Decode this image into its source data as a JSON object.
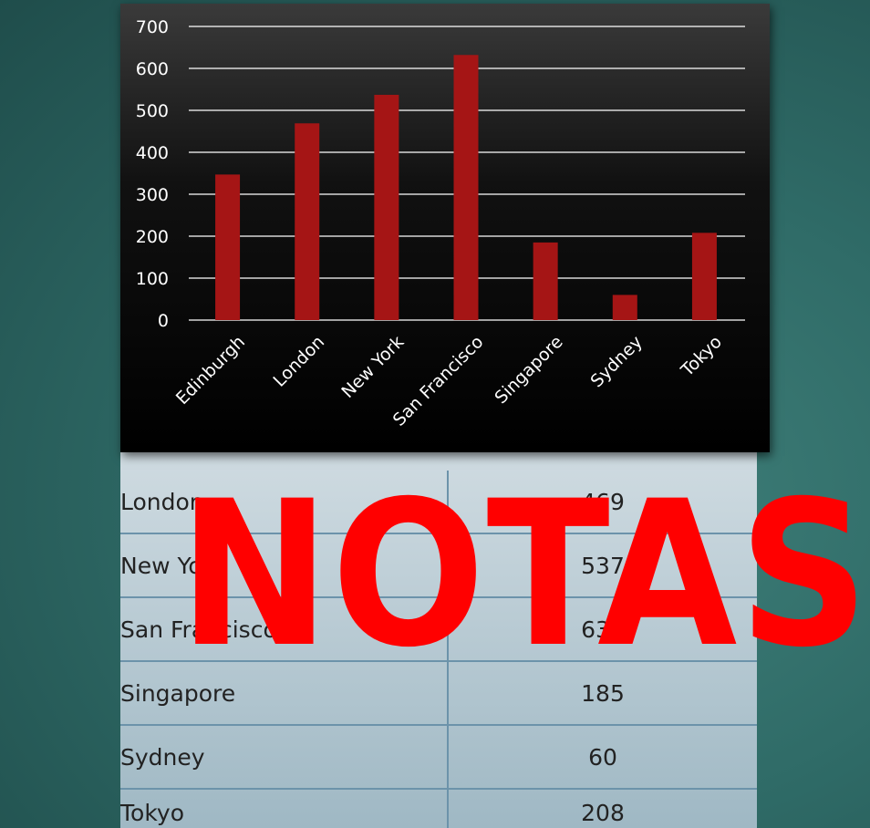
{
  "chart_data": {
    "type": "bar",
    "categories": [
      "Edinburgh",
      "London",
      "New York",
      "San Francisco",
      "Singapore",
      "Sydney",
      "Tokyo"
    ],
    "values": [
      347,
      469,
      537,
      632,
      185,
      60,
      208
    ],
    "ylim": [
      0,
      700
    ],
    "yticks": [
      0,
      100,
      200,
      300,
      400,
      500,
      600,
      700
    ],
    "grid": true,
    "colors": {
      "bar": "#a51515",
      "grid": "#ffffff",
      "text": "#ffffff"
    }
  },
  "table": {
    "rows": [
      {
        "city": "London",
        "value": "469"
      },
      {
        "city": "New York",
        "value": "537"
      },
      {
        "city": "San Francisco",
        "value": "632"
      },
      {
        "city": "Singapore",
        "value": "185"
      },
      {
        "city": "Sydney",
        "value": "60"
      },
      {
        "city": "Tokyo",
        "value": "208"
      }
    ]
  },
  "overlay": {
    "text": "NOTAS",
    "color": "#ff0000"
  }
}
